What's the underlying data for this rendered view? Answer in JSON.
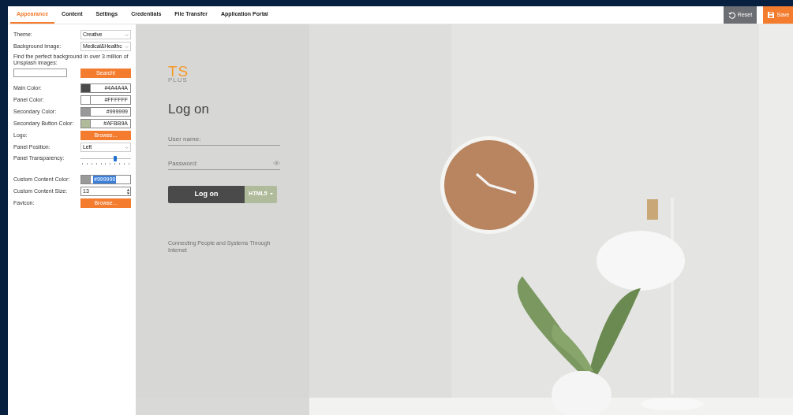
{
  "tabs": [
    {
      "label": "Appearance",
      "selected": true
    },
    {
      "label": "Content",
      "selected": false
    },
    {
      "label": "Settings",
      "selected": false
    },
    {
      "label": "Credentials",
      "selected": false
    },
    {
      "label": "File Transfer",
      "selected": false
    },
    {
      "label": "Application Portal",
      "selected": false
    }
  ],
  "actions": [
    {
      "kind": "reset",
      "label": "Reset"
    },
    {
      "kind": "save",
      "label": "Save"
    }
  ],
  "settings": [
    {
      "kind": "select",
      "label": "Theme:",
      "value": "Creative"
    },
    {
      "kind": "select",
      "label": "Background image:",
      "value": "Medical&Healthc"
    },
    {
      "kind": "search",
      "label": "Find the perfect background in over 3 million of Unsplash images:",
      "button": "Search!"
    },
    {
      "kind": "color",
      "label": "Main Color:",
      "value": "#4A4A4A",
      "color": "#4a4a4a",
      "highlighted": false
    },
    {
      "kind": "color",
      "label": "Panel Color:",
      "value": "#FFFFFF",
      "color": "#ffffff",
      "highlighted": false
    },
    {
      "kind": "color",
      "label": "Secondary Color:",
      "value": "#999999",
      "color": "#999999",
      "highlighted": false
    },
    {
      "kind": "color",
      "label": "Secondary Button Color:",
      "value": "#AFBB9A",
      "color": "#afbb9a",
      "highlighted": false
    },
    {
      "kind": "browse",
      "label": "Logo:",
      "button": "Browse..."
    },
    {
      "kind": "select",
      "label": "Panel Position:",
      "value": "Left"
    },
    {
      "kind": "slider",
      "label": "Panel Transparency:",
      "level": 0.68
    },
    {
      "kind": "color",
      "label": "Custom Content Color:",
      "value": "#999999",
      "color": "#999999",
      "highlighted": true
    },
    {
      "kind": "spinner",
      "label": "Custom Content Size:",
      "value": "13"
    },
    {
      "kind": "browse",
      "label": "Favicon:",
      "button": "Browse..."
    }
  ],
  "preview": {
    "logo_top": "TS",
    "logo_bottom": "PLUS",
    "title": "Log on",
    "username_placeholder": "User name:",
    "password_placeholder": "Password:",
    "login_button": "Log on",
    "mode_button": "HTML5",
    "tagline": "Connecting People and Systems Through Internet"
  }
}
